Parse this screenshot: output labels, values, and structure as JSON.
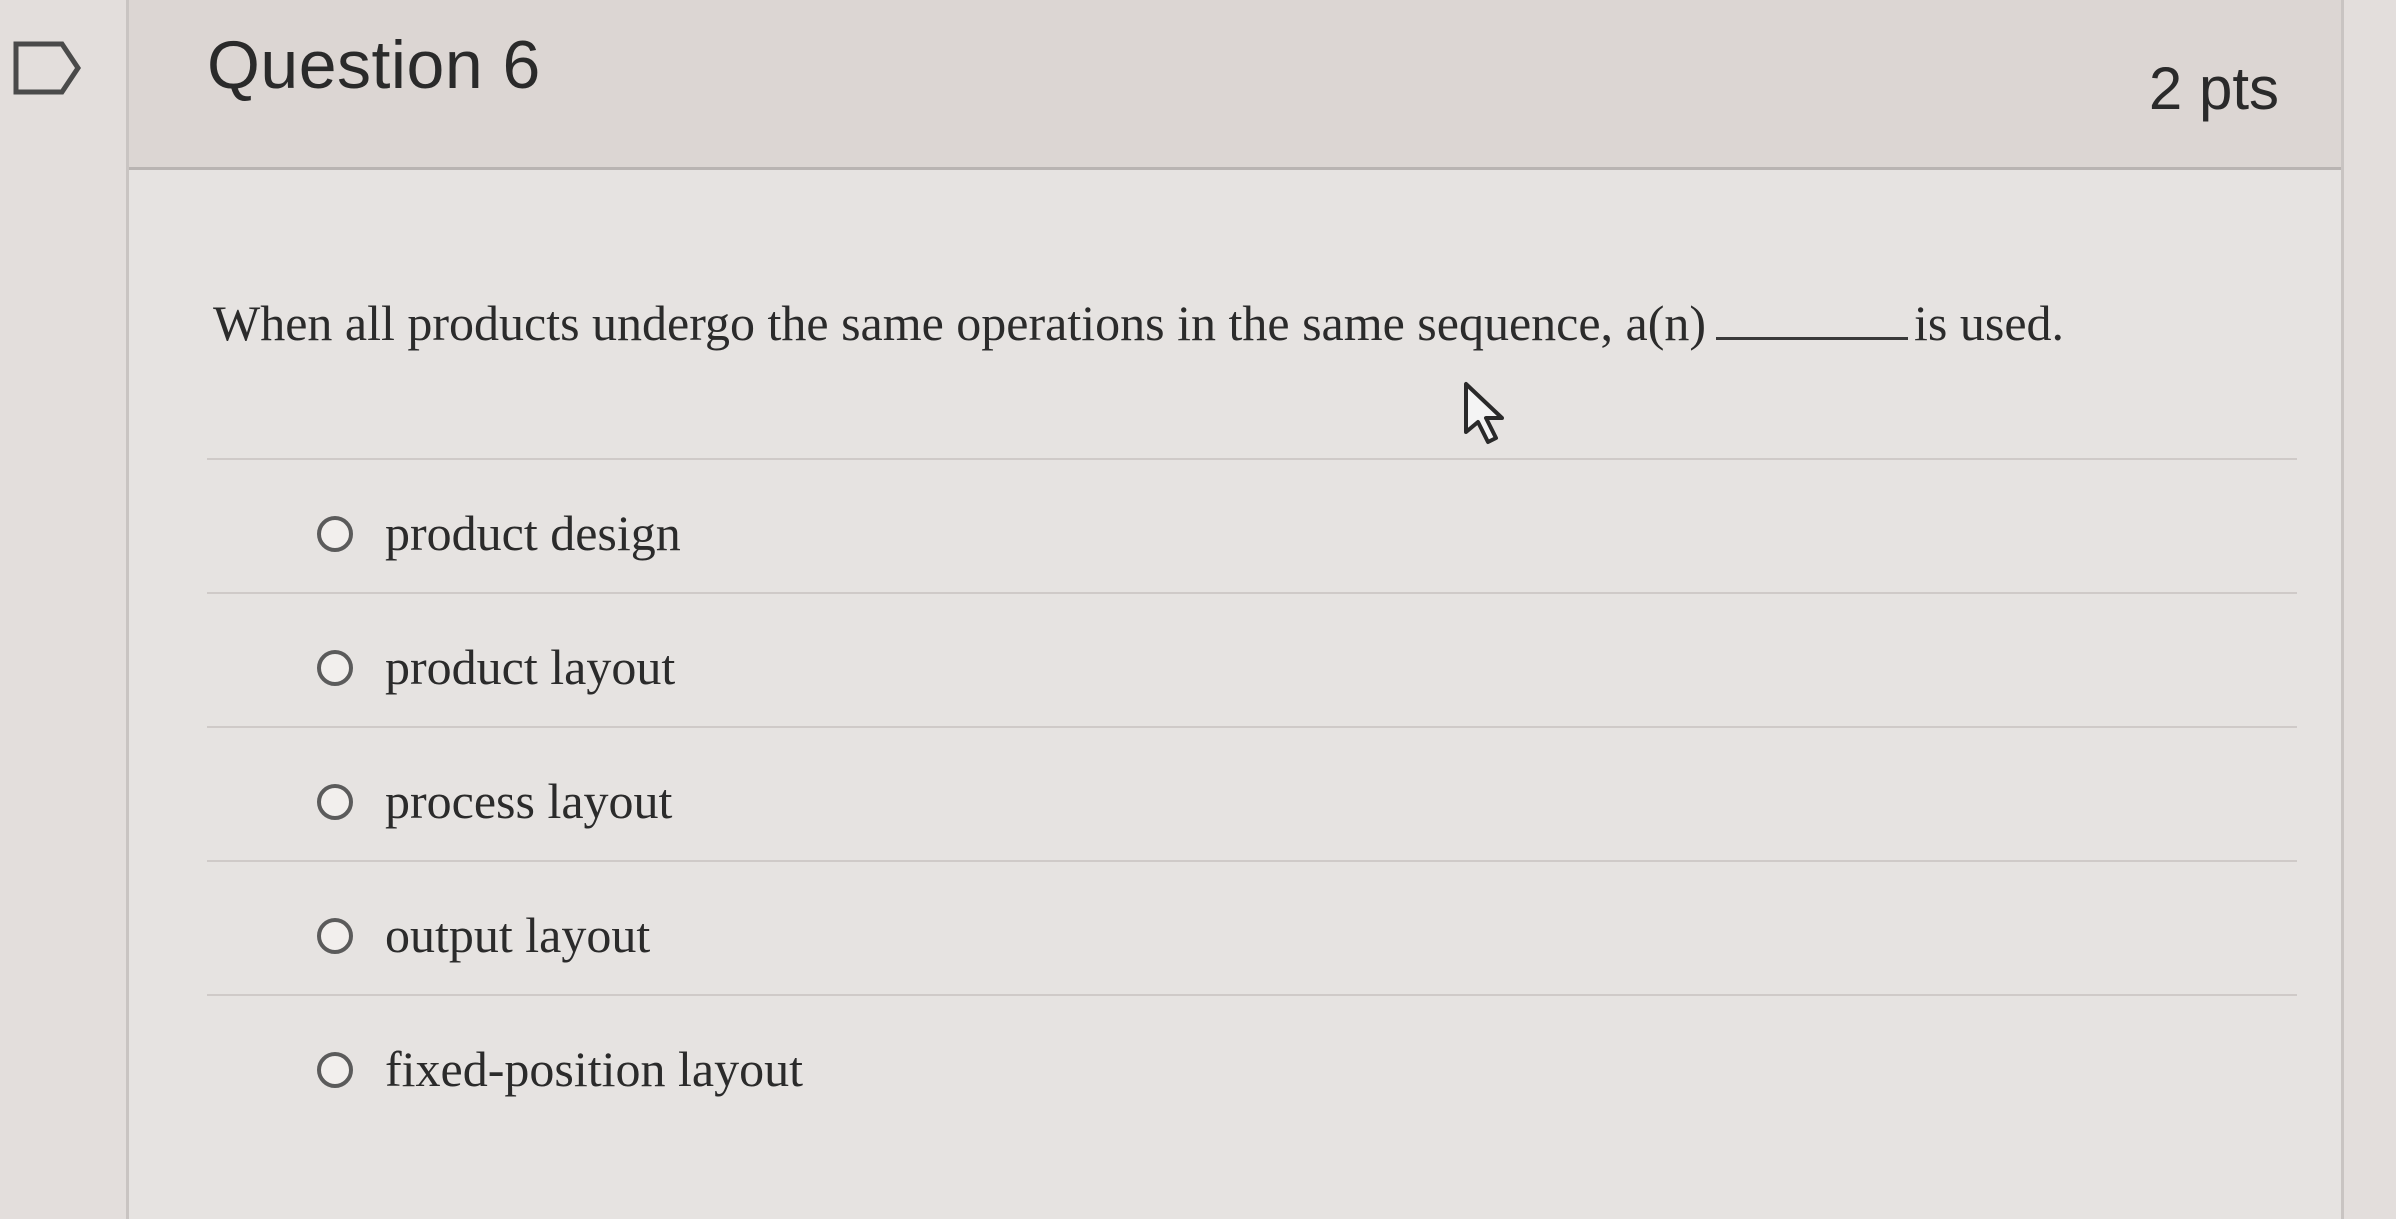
{
  "question": {
    "title": "Question 6",
    "points": "2 pts",
    "text_before": "When all products undergo the same operations in the same sequence, a(n)",
    "text_after": "is used."
  },
  "answers": [
    {
      "label": "product design",
      "selected": false
    },
    {
      "label": "product layout",
      "selected": false
    },
    {
      "label": "process layout",
      "selected": false
    },
    {
      "label": "output layout",
      "selected": false
    },
    {
      "label": "fixed-position layout",
      "selected": false
    }
  ],
  "icons": {
    "flag": "flag-question-icon",
    "cursor": "mouse-pointer-icon"
  },
  "colors": {
    "background": "#e3dedc",
    "header": "#dcd6d3",
    "text": "#2b2b2b"
  }
}
